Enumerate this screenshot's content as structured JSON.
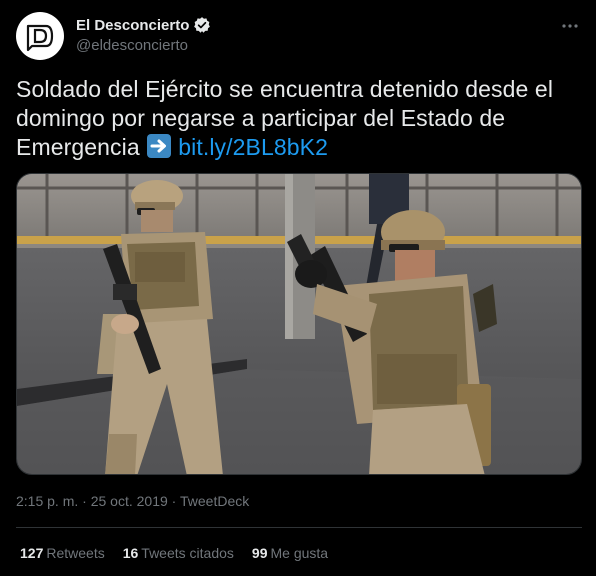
{
  "author": {
    "display_name": "El Desconcierto",
    "handle": "@eldesconcierto",
    "avatar_letter": "D",
    "verified": true
  },
  "tweet": {
    "line1": "Soldado del Ejército se encuentra detenido desde el",
    "line2": "domingo por negarse a participar del Estado de",
    "line3": "Emergencia",
    "link": "bit.ly/2BL8bK2",
    "emoji": "arrow-right-emoji"
  },
  "media": {
    "description_icon": "photo"
  },
  "meta": {
    "time": "2:15 p. m.",
    "separator": " · ",
    "date": "25 oct. 2019",
    "source": "TweetDeck"
  },
  "stats": {
    "retweets_count": "127",
    "retweets_label": "Retweets",
    "quotes_count": "16",
    "quotes_label": "Tweets citados",
    "likes_count": "99",
    "likes_label": "Me gusta"
  },
  "colors": {
    "background": "#000000",
    "text": "#e7e9ea",
    "secondary": "#71767b",
    "link": "#1d9bf0",
    "divider": "#2f3336"
  }
}
